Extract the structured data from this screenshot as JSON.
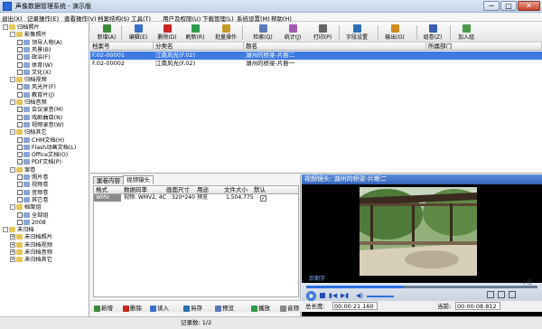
{
  "window": {
    "title": "声像数据管理系统 - 演示版",
    "minimize": "─",
    "maximize": "□",
    "close": "✕"
  },
  "menu": [
    "退出(X)",
    "记录操作(E)",
    "查看操作(V)",
    "档案结构(S)",
    "工具(T)",
    "用户及权限(U)",
    "下载管理(L)",
    "系统设置(M)",
    "帮助(H)"
  ],
  "toolbar": [
    {
      "label": "新增(A)",
      "icon": "new-icon",
      "color": "#3a8a3a"
    },
    {
      "label": "编辑(E)",
      "icon": "edit-icon",
      "color": "#3b6fc9"
    },
    {
      "label": "删除(D)",
      "icon": "delete-icon",
      "color": "#cc2222"
    },
    {
      "label": "刷新(R)",
      "icon": "refresh-icon",
      "color": "#2f9a4a"
    },
    {
      "label": "批量操作",
      "icon": "batch-icon",
      "color": "#c49a2a"
    },
    {
      "label": "检索(Q)",
      "icon": "search-icon",
      "color": "#5a7ab8"
    },
    {
      "label": "统计(J)",
      "icon": "stats-icon",
      "color": "#a05ab0"
    },
    {
      "label": "打印(P)",
      "icon": "print-icon",
      "color": "#666666"
    },
    {
      "label": "字段设置",
      "icon": "fields-icon",
      "color": "#2b6fb3"
    },
    {
      "label": "输出(O)",
      "icon": "export-icon",
      "color": "#d08a20"
    },
    {
      "label": "组卷(Z)",
      "icon": "volume-icon",
      "color": "#3a5fb0"
    },
    {
      "label": "加入组",
      "icon": "add-group-icon",
      "color": "#4a9a4a"
    }
  ],
  "tree": [
    {
      "label": "归档照片",
      "level": 0,
      "icon": "folder",
      "exp": "-"
    },
    {
      "label": "影像照片",
      "level": 1,
      "icon": "folder",
      "exp": "-"
    },
    {
      "label": "领导人物(A)",
      "level": 2,
      "icon": "leaf"
    },
    {
      "label": "风景(B)",
      "level": 2,
      "icon": "leaf"
    },
    {
      "label": "政治(F)",
      "level": 2,
      "icon": "leaf"
    },
    {
      "label": "体育(W)",
      "level": 2,
      "icon": "leaf"
    },
    {
      "label": "文化(X)",
      "level": 2,
      "icon": "leaf"
    },
    {
      "label": "归档视频",
      "level": 1,
      "icon": "folder",
      "exp": "-"
    },
    {
      "label": "风光片(F)",
      "level": 2,
      "icon": "leaf"
    },
    {
      "label": "教育片(J)",
      "level": 2,
      "icon": "leaf"
    },
    {
      "label": "归档音频",
      "level": 1,
      "icon": "folder",
      "exp": "-"
    },
    {
      "label": "会议录音(M)",
      "level": 2,
      "icon": "leaf"
    },
    {
      "label": "戏剧曲目(N)",
      "level": 2,
      "icon": "leaf"
    },
    {
      "label": "视频录音(W)",
      "level": 2,
      "icon": "leaf"
    },
    {
      "label": "归档其它",
      "level": 1,
      "icon": "folder",
      "exp": "-"
    },
    {
      "label": "CHM文档(H)",
      "level": 2,
      "icon": "leaf"
    },
    {
      "label": "Flash动画文档(L)",
      "level": 2,
      "icon": "leaf"
    },
    {
      "label": "Office文档(O)",
      "level": 2,
      "icon": "leaf"
    },
    {
      "label": "PDF文档(P)",
      "level": 2,
      "icon": "leaf"
    },
    {
      "label": "案卷",
      "level": 1,
      "icon": "folder",
      "exp": "-"
    },
    {
      "label": "照片卷",
      "level": 2,
      "icon": "leaf"
    },
    {
      "label": "视频卷",
      "level": 2,
      "icon": "leaf"
    },
    {
      "label": "音频卷",
      "level": 2,
      "icon": "leaf"
    },
    {
      "label": "其它卷",
      "level": 2,
      "icon": "leaf"
    },
    {
      "label": "档案组",
      "level": 1,
      "icon": "folder",
      "exp": "-"
    },
    {
      "label": "全部组",
      "level": 2,
      "icon": "leaf"
    },
    {
      "label": "2008",
      "level": 2,
      "icon": "leaf"
    },
    {
      "label": "未归档",
      "level": 0,
      "icon": "folder",
      "exp": "-"
    },
    {
      "label": "未归档照片",
      "level": 1,
      "icon": "folder",
      "exp": "+"
    },
    {
      "label": "未归档视频",
      "level": 1,
      "icon": "folder",
      "exp": "+"
    },
    {
      "label": "未归档音频",
      "level": 1,
      "icon": "folder",
      "exp": "+"
    },
    {
      "label": "未归档其它",
      "level": 1,
      "icon": "folder",
      "exp": "+"
    }
  ],
  "grid": {
    "columns": [
      "档案号",
      "分类名",
      "题名",
      "所属部门"
    ],
    "rows": [
      {
        "id": "F.02-00001",
        "category": "江南风光(F.02)",
        "title": "湖州的桥梁-片断二",
        "dept": "",
        "selected": true
      },
      {
        "id": "F.02-00002",
        "category": "江南风光(F.02)",
        "title": "湖州的桥梁-片断一",
        "dept": "",
        "selected": false
      }
    ]
  },
  "tabs": [
    "案卷内容",
    "视频镜头"
  ],
  "sub": {
    "columns": [
      "格式",
      "数据码率",
      "画面尺寸",
      "用途",
      "文件大小",
      "默认"
    ],
    "row": {
      "format": "WMV",
      "rate": "视频: WMV2, 4C",
      "size": "320*240",
      "usage": "预览",
      "filesize": "1,504,775",
      "default": "✓"
    }
  },
  "bottom_toolbar": [
    "新增",
    "删除",
    "读入",
    "另存",
    "预览",
    "播放",
    "音频"
  ],
  "video": {
    "header": "视频镜头: 湖州的桥梁-片断二",
    "caption": "后期字",
    "total_label": "总长度:",
    "total": "00:00:21.160",
    "current_label": "当前:",
    "current": "00:00:08.812",
    "progress": 0.42,
    "corner": "小型"
  },
  "status": {
    "record": "记录数: 1/2"
  }
}
